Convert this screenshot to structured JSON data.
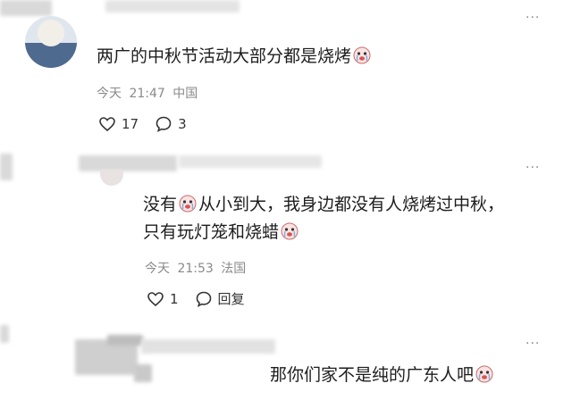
{
  "comments": [
    {
      "text": "两广的中秋节活动大部分都是烧烤",
      "day": "今天",
      "time": "21:47",
      "location": "中国",
      "likes": "17",
      "replies": "3"
    },
    {
      "line1_a": "没有",
      "line1_b": "从小到大，我身边都没有人烧烤过中秋，",
      "line2": "只有玩灯笼和烧蜡",
      "day": "今天",
      "time": "21:53",
      "location": "法国",
      "likes": "1",
      "reply_label": "回复"
    },
    {
      "text": "那你们家不是纯的广东人吧"
    }
  ],
  "icons": [
    "heart-icon",
    "comment-bubble-icon",
    "more-icon",
    "crying-emoji-icon"
  ],
  "colors": {
    "meta": "#8a8a8a",
    "text": "#1d1d1d",
    "emoji_face": "#f3c5c5"
  }
}
